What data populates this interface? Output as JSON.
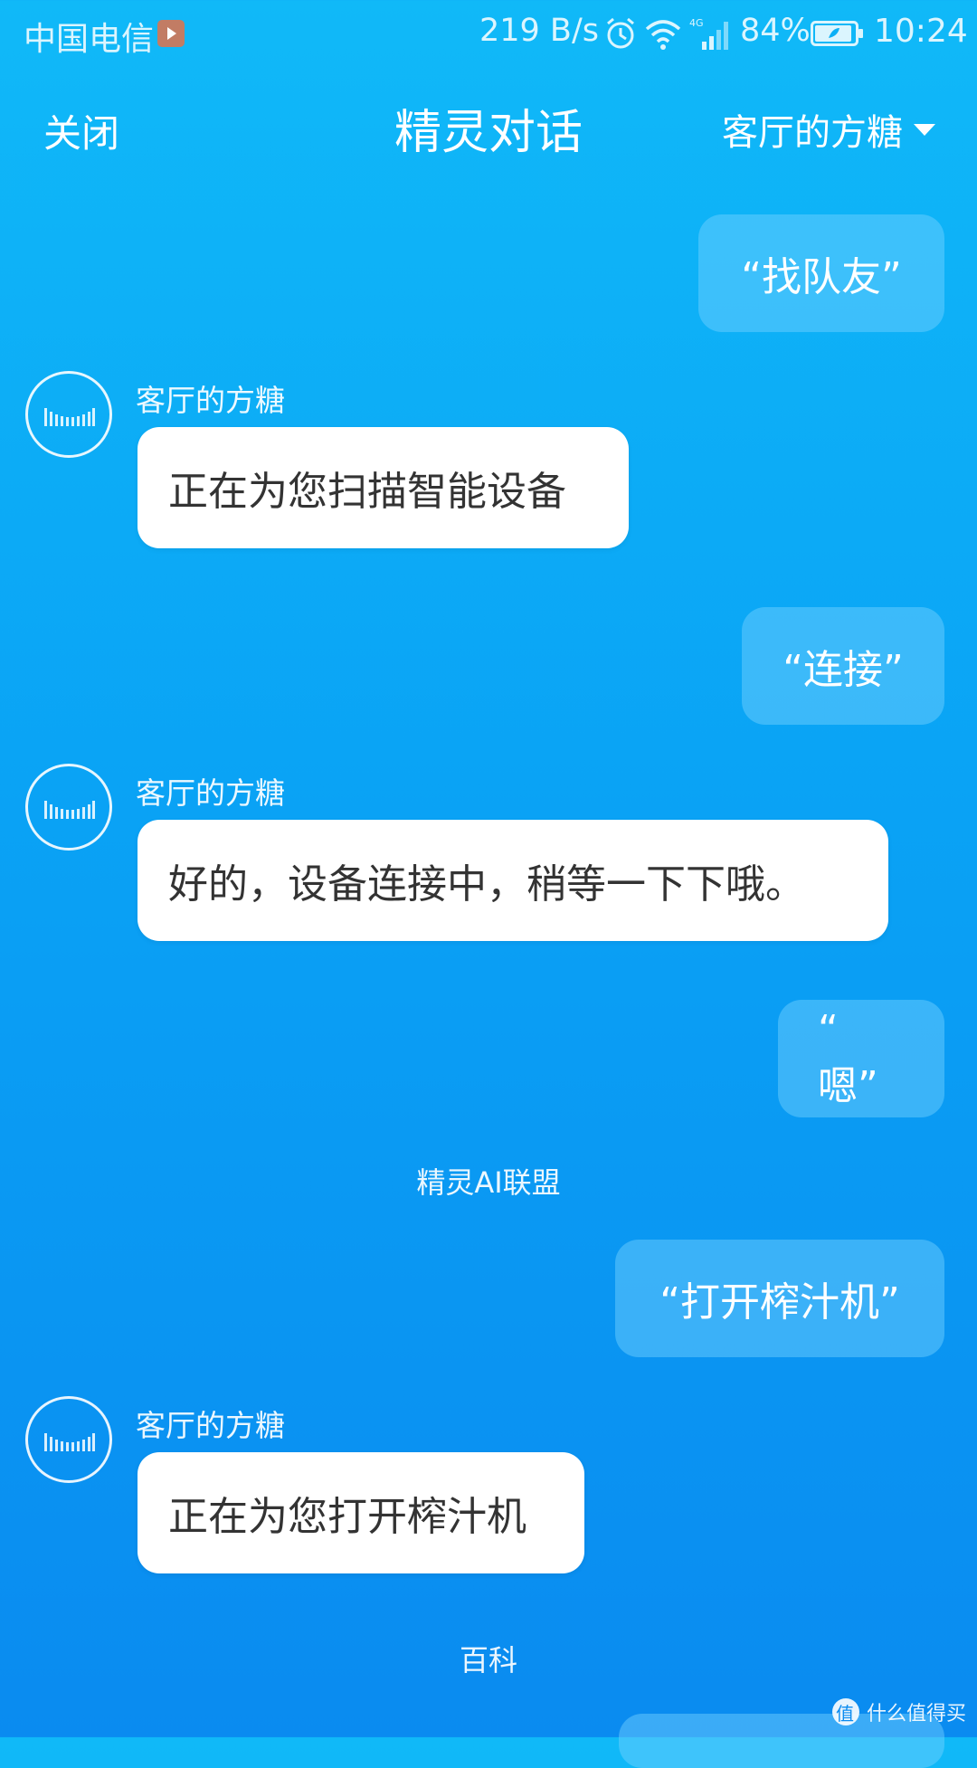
{
  "status_bar": {
    "carrier": "中国电信",
    "speed": "219 B/s",
    "network_type": "4G",
    "battery": "84%",
    "time": "10:24",
    "icons": [
      "play-badge-icon",
      "alarm-icon",
      "wifi-icon",
      "signal-icon",
      "battery-icon"
    ]
  },
  "nav": {
    "close_label": "关闭",
    "title": "精灵对话",
    "device": "客厅的方糖"
  },
  "messages": [
    {
      "type": "user",
      "text": "“找队友”"
    },
    {
      "type": "bot",
      "name": "客厅的方糖",
      "text": "正在为您扫描智能设备"
    },
    {
      "type": "user",
      "text": "“连接”"
    },
    {
      "type": "bot",
      "name": "客厅的方糖",
      "text": "好的，设备连接中，稍等一下下哦。"
    },
    {
      "type": "user",
      "text": "“ 嗯”"
    },
    {
      "type": "section",
      "text": "精灵AI联盟"
    },
    {
      "type": "user",
      "text": "“打开榨汁机”"
    },
    {
      "type": "bot",
      "name": "客厅的方糖",
      "text": "正在为您打开榨汁机"
    },
    {
      "type": "section",
      "text": "百科"
    }
  ],
  "watermark": "什么值得买",
  "colors": {
    "background_top": "#10b9f8",
    "background_bottom": "#0a8bf0",
    "bot_bubble": "#ffffff",
    "bot_text": "#333333"
  }
}
